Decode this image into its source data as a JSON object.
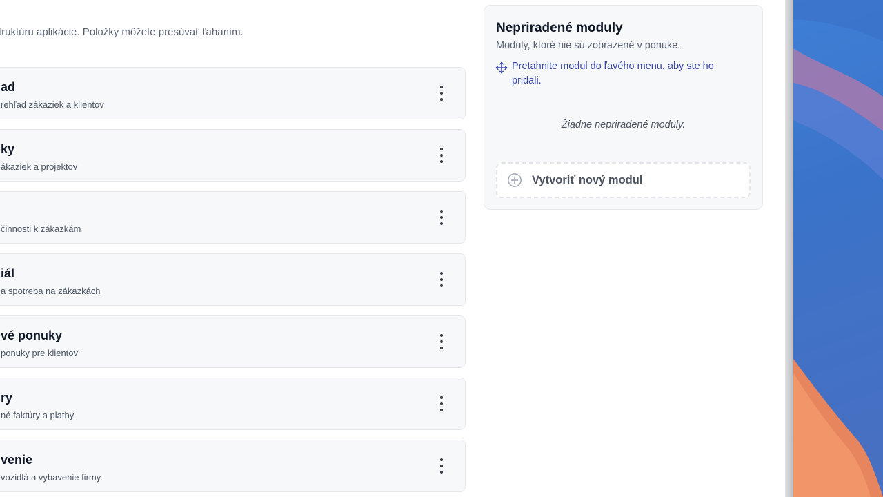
{
  "page": {
    "subtitle": "truktúru aplikácie. Položky môžete presúvať ťahaním."
  },
  "modules": [
    {
      "name": "ad",
      "desc": "rehľad zákaziek a klientov"
    },
    {
      "name": "ky",
      "desc": "ákaziek a projektov"
    },
    {
      "name": "",
      "desc": "činnosti k zákazkám"
    },
    {
      "name": "iál",
      "desc": "a spotreba na zákazkách"
    },
    {
      "name": "vé ponuky",
      "desc": "ponuky pre klientov"
    },
    {
      "name": "ry",
      "desc": "né faktúry a platby"
    },
    {
      "name": "venie",
      "desc": "vozidlá a vybavenie firmy"
    }
  ],
  "unassigned": {
    "title": "Nepriradené moduly",
    "subtitle": "Moduly, ktoré nie sú zobrazené v ponuke.",
    "hint_line1": "Pretahnite modul do ľavého menu, aby ste ho",
    "hint_line2": "pridali.",
    "empty_text": "Žiadne nepriradené moduly.",
    "create_label": "Vytvoriť nový modul"
  },
  "icons": {
    "more": "more-vertical-icon",
    "move": "move-icon",
    "plus": "plus-circle-icon"
  },
  "colors": {
    "accent": "#3845a8",
    "card_bg": "#f7f8fa",
    "card_border": "#e6e8ec",
    "text_primary": "#111827",
    "text_secondary": "#4b5563"
  }
}
